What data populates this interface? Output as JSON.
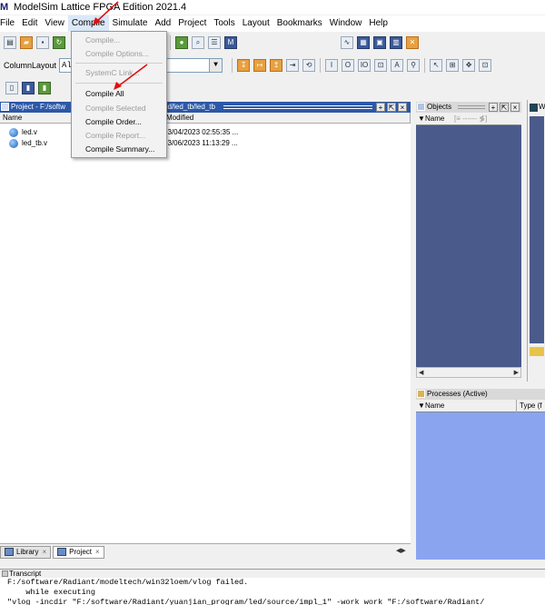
{
  "window": {
    "title": "ModelSim Lattice FPGA Edition 2021.4",
    "logo_letter": "M"
  },
  "menubar": [
    "File",
    "Edit",
    "View",
    "Compile",
    "Simulate",
    "Add",
    "Project",
    "Tools",
    "Layout",
    "Bookmarks",
    "Window",
    "Help"
  ],
  "toolbar": {
    "column_layout_label": "ColumnLayout",
    "column_layout_value": "All"
  },
  "compile_menu": [
    {
      "label": "Compile...",
      "enabled": false
    },
    {
      "label": "Compile Options...",
      "enabled": false
    },
    {
      "label": "SystemC Link...",
      "enabled": false
    },
    {
      "label": "Compile All",
      "enabled": true
    },
    {
      "label": "Compile Selected",
      "enabled": false
    },
    {
      "label": "Compile Order...",
      "enabled": true
    },
    {
      "label": "Compile Report...",
      "enabled": false
    },
    {
      "label": "Compile Summary...",
      "enabled": true
    }
  ],
  "project": {
    "header_left": "Project - F:/softw",
    "header_right": "ed/led_tb/led_tb",
    "columns": {
      "name": "Name",
      "modified": "Modified"
    },
    "files": [
      {
        "name": "led.v",
        "modified": "03/04/2023 02:55:35 ..."
      },
      {
        "name": "led_tb.v",
        "modified": "03/06/2023 11:13:29 ..."
      }
    ]
  },
  "bottom_tabs": [
    {
      "label": "Library"
    },
    {
      "label": "Project"
    }
  ],
  "objects": {
    "title": "Objects",
    "col_name": "Name"
  },
  "processes": {
    "title": "Processes (Active)",
    "col_name": "Name",
    "col_type": "Type (f"
  },
  "transcript": {
    "title": "Transcript",
    "lines": [
      "F:/software/Radiant/modeltech/win32loem/vlog failed.",
      "    while executing",
      "\"vlog -incdir \"F:/software/Radiant/yuanjian_program/led/source/impl_1\" -work work \"F:/software/Radiant/"
    ]
  }
}
